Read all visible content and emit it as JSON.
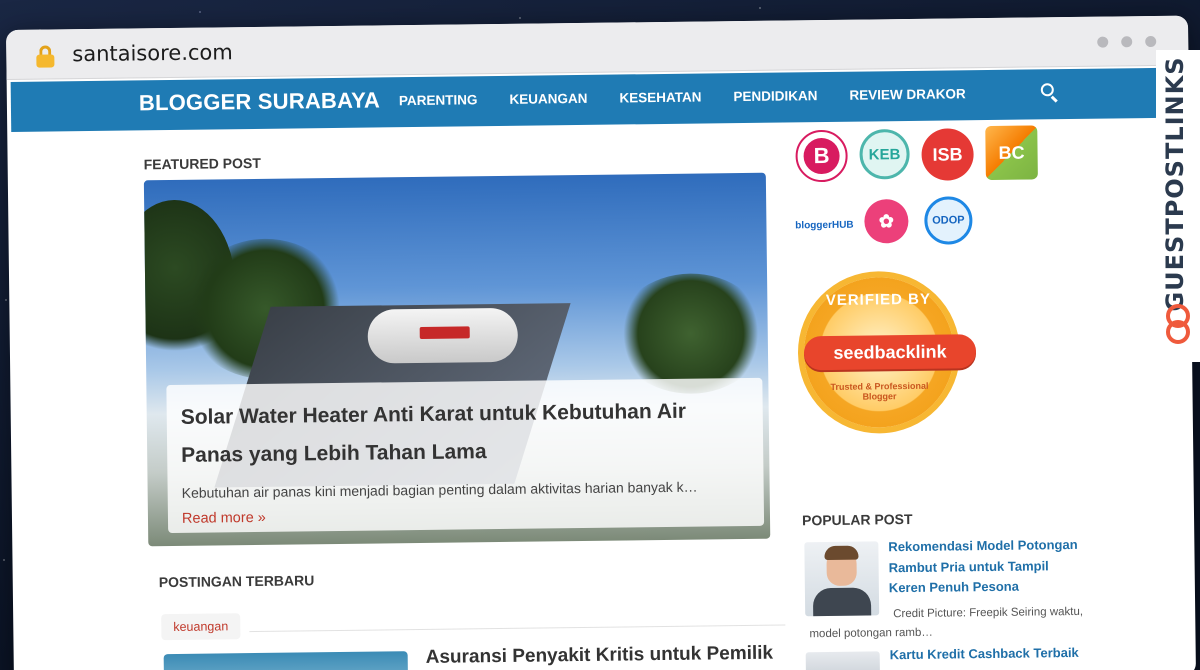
{
  "browser": {
    "url": "santaisore.com"
  },
  "nav": {
    "brand": "BLOGGER SURABAYA",
    "items": [
      "PARENTING",
      "KEUANGAN",
      "KESEHATAN",
      "PENDIDIKAN",
      "REVIEW DRAKOR"
    ]
  },
  "featured": {
    "section_title": "FEATURED POST",
    "title": "Solar Water Heater Anti Karat untuk Kebutuhan Air Panas yang Lebih Tahan Lama",
    "excerpt": "Kebutuhan air panas kini menjadi bagian penting dalam aktivitas harian banyak k…",
    "read_more": "Read more »"
  },
  "latest": {
    "section_title": "POSTINGAN TERBARU",
    "tag": "keuangan",
    "post_title": "Asuransi Penyakit Kritis untuk Pemilik"
  },
  "sidebar": {
    "logos": [
      {
        "name": "blogger-perempuan-logo",
        "label": "B",
        "color": "#d81b60"
      },
      {
        "name": "kumpulan-emak-blogger-logo",
        "label": "KEB",
        "color": "#26a69a"
      },
      {
        "name": "isb-logo",
        "label": "ISB",
        "color": "#e53935"
      },
      {
        "name": "bloggercrony-logo",
        "label": "BC",
        "color": "#f57c00"
      },
      {
        "name": "bloggerhub-logo",
        "label": "bloggerHUB",
        "color": "#1565c0"
      },
      {
        "name": "lotus-logo",
        "label": "",
        "color": "#ec407a"
      },
      {
        "name": "odop-logo",
        "label": "ODOP",
        "color": "#1e88e5"
      }
    ],
    "seal": {
      "top": "VERIFIED BY",
      "brand": "seedbacklink",
      "bottom": "Trusted & Professional Blogger"
    },
    "popular_title": "POPULAR POST",
    "popular": [
      {
        "title": "Rekomendasi Model Potongan Rambut Pria untuk Tampil Keren Penuh Pesona",
        "desc": "Credit Picture: Freepik Seiring waktu, model potongan ramb…"
      },
      {
        "title": "Kartu Kredit Cashback Terbaik"
      }
    ]
  },
  "watermark": {
    "text": "GUESTPOSTLINKS"
  }
}
